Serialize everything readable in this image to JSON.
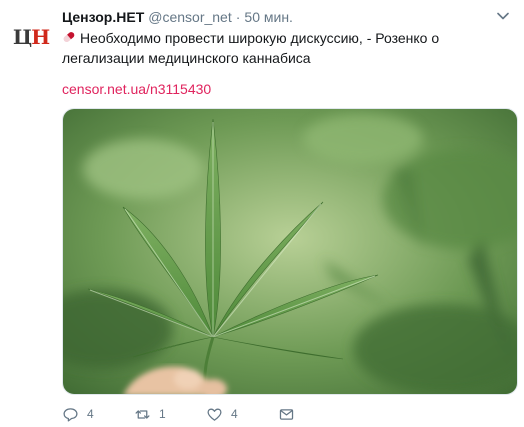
{
  "account": {
    "name": "Цензор.НЕТ",
    "handle": "@censor_net",
    "separator": "·",
    "time": "50 мин.",
    "avatar_left": "Ц",
    "avatar_right": "Н"
  },
  "tweet": {
    "text": "Необходимо провести широкую дискуссию, - Розенко о легализации медицинского каннабиса",
    "link": "censor.net.ua/n3115430",
    "emoji": "pill-emoji"
  },
  "actions": {
    "reply_count": "4",
    "retweet_count": "1",
    "like_count": "4"
  },
  "colors": {
    "link": "#e0245e",
    "muted": "#657786",
    "text": "#14171a",
    "logo_red": "#d0281b"
  }
}
